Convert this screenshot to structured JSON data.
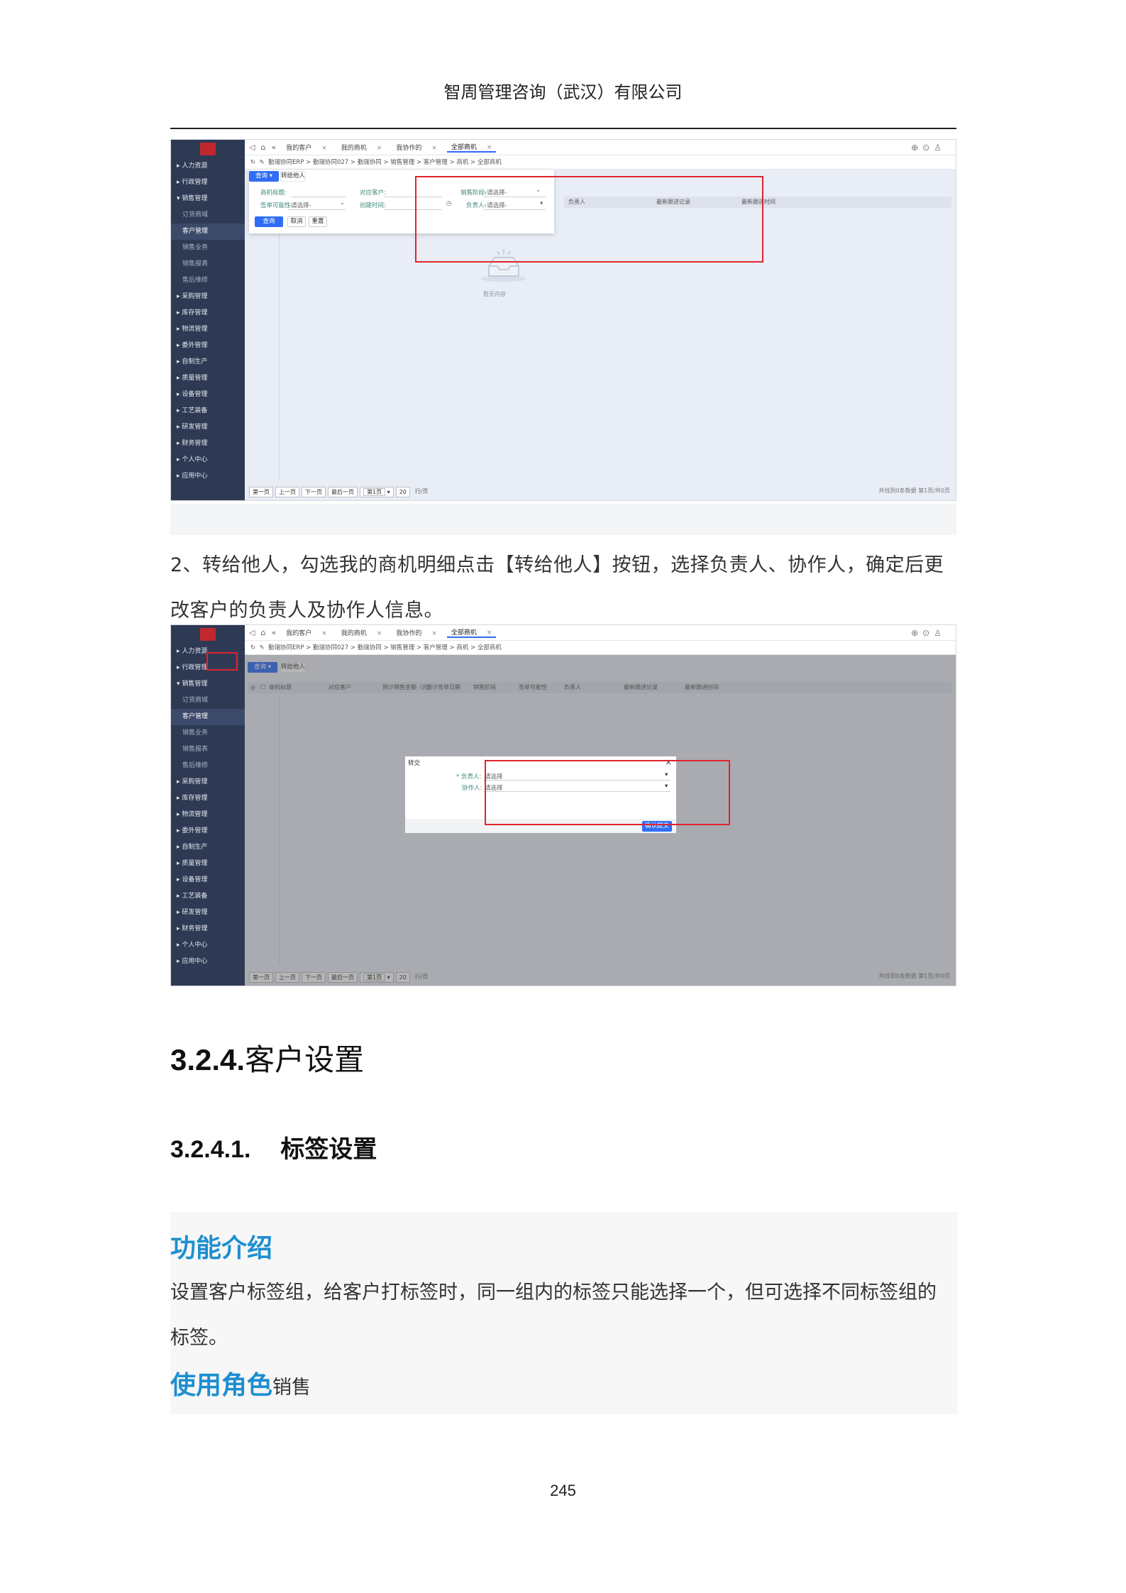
{
  "header": {
    "company": "智周管理咨询（武汉）有限公司"
  },
  "app": {
    "menu": [
      {
        "label": "▸ 人力资源",
        "sub": false
      },
      {
        "label": "▸ 行政管理",
        "sub": false
      },
      {
        "label": "▾ 销售管理",
        "sub": false
      },
      {
        "label": "订货商城",
        "sub": true
      },
      {
        "label": "客户管理",
        "sub": true,
        "active": true
      },
      {
        "label": "销售业务",
        "sub": true
      },
      {
        "label": "销售报表",
        "sub": true
      },
      {
        "label": "售后维修",
        "sub": true
      },
      {
        "label": "▸ 采购管理",
        "sub": false
      },
      {
        "label": "▸ 库存管理",
        "sub": false
      },
      {
        "label": "▸ 物流管理",
        "sub": false
      },
      {
        "label": "▸ 委外管理",
        "sub": false
      },
      {
        "label": "▸ 自制生产",
        "sub": false
      },
      {
        "label": "▸ 质量管理",
        "sub": false
      },
      {
        "label": "▸ 设备管理",
        "sub": false
      },
      {
        "label": "▸ 工艺装备",
        "sub": false
      },
      {
        "label": "▸ 研发管理",
        "sub": false
      },
      {
        "label": "▸ 财务管理",
        "sub": false
      },
      {
        "label": "▸ 个人中心",
        "sub": false
      },
      {
        "label": "▸ 应用中心",
        "sub": false
      }
    ],
    "tabs": [
      "我的客户",
      "我的商机",
      "我协作的",
      "全部商机"
    ],
    "breadcrumb": "勤瑞协同ERP > 勤瑞协同027 > 勤瑞协同 > 销售管理 > 客户管理 > 商机 > 全部商机",
    "query_btn": "查询",
    "transfer_btn": "转给他人",
    "columns": [
      "商机标题",
      "对应客户",
      "预计销售金额（元）",
      "预计签单日期",
      "销售阶段",
      "签单可能性",
      "负责人",
      "最新跟进记录",
      "最新跟进时间"
    ],
    "pager": [
      "第一页",
      "上一页",
      "下一页",
      "最后一页",
      "第1页",
      "20",
      "行/页"
    ],
    "pager_summary": "共找到0条数据 第1页/共0页",
    "search_form": {
      "title_label": "商机标题:",
      "customer_label": "对应客户:",
      "stage_label": "销售阶段:",
      "stage_value": "-请选择-",
      "probability_label": "签单可能性:",
      "probability_value": "-请选择-",
      "created_label": "创建时间:",
      "owner_label": "负责人:",
      "owner_value": "-请选择-",
      "search_btn": "查询",
      "cancel_btn": "取消",
      "reset_btn": "重置"
    },
    "empty_text": "暂无内容",
    "modal": {
      "title": "转交",
      "owner_label": "* 负责人:",
      "owner_value": "请选择",
      "collab_label": "协作人:",
      "collab_value": "请选择",
      "confirm_btn": "确认提交"
    }
  },
  "text": {
    "step2_line1": "2、转给他人，勾选我的商机明细点击【转给他人】按钮，选择负责人、协作人，确定后更",
    "step2_line2": "改客户的负责人及协作人信息。",
    "section_num": "3.2.4.",
    "section_title": "客户设置",
    "subsection_num": "3.2.4.1.",
    "subsection_title": "标签设置",
    "intro_title": "功能介绍",
    "intro_body_1": "设置客户标签组，给客户打标签时，同一组内的标签只能选择一个，但可选择不同标签组的",
    "intro_body_2": "标签。",
    "role_title": "使用角色",
    "role_value": "销售"
  },
  "page_number": "245",
  "colors": {
    "accent": "#2f6df6",
    "sidebar": "#2e3a54",
    "highlight": "#e0242b",
    "heading_blue": "#1d8fd0"
  }
}
